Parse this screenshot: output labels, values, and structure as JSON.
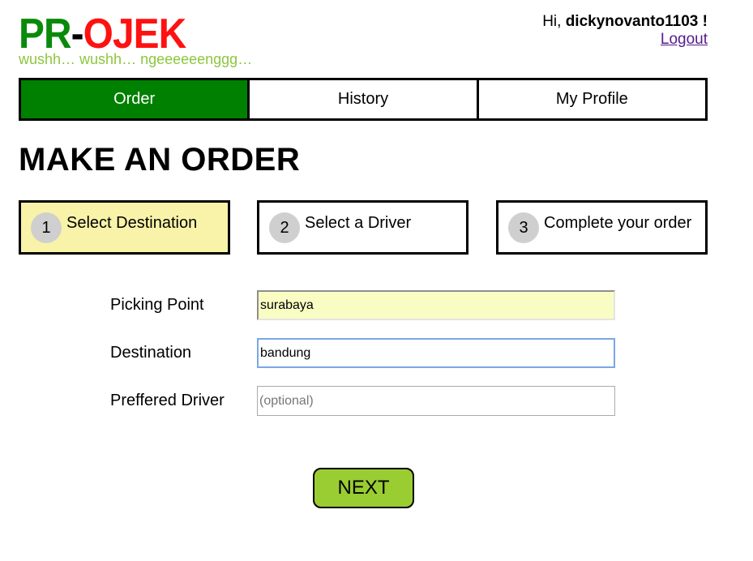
{
  "header": {
    "logo": {
      "part1": "PR",
      "separator": "-",
      "part2": "OJEK"
    },
    "tagline": "wushh… wushh… ngeeeeeenggg…",
    "greeting_prefix": "Hi, ",
    "username": "dickynovanto1103",
    "greeting_suffix": " !",
    "logout_label": "Logout"
  },
  "nav": {
    "tabs": [
      {
        "label": "Order",
        "active": true
      },
      {
        "label": "History",
        "active": false
      },
      {
        "label": "My Profile",
        "active": false
      }
    ]
  },
  "page_title": "MAKE AN ORDER",
  "steps": [
    {
      "number": "1",
      "label": "Select Destination",
      "active": true
    },
    {
      "number": "2",
      "label": "Select a Driver",
      "active": false
    },
    {
      "number": "3",
      "label": "Complete your order",
      "active": false
    }
  ],
  "form": {
    "picking_point": {
      "label": "Picking Point",
      "value": "surabaya",
      "placeholder": ""
    },
    "destination": {
      "label": "Destination",
      "value": "bandung",
      "placeholder": ""
    },
    "preferred_driver": {
      "label": "Preffered Driver",
      "value": "",
      "placeholder": "(optional)"
    }
  },
  "next_button_label": "NEXT",
  "colors": {
    "logo_green": "#0a8a0a",
    "logo_red": "#ff1111",
    "tagline_green": "#8dc63f",
    "active_tab": "#008000",
    "active_step": "#f8f3a8",
    "next_button": "#9acd32"
  }
}
